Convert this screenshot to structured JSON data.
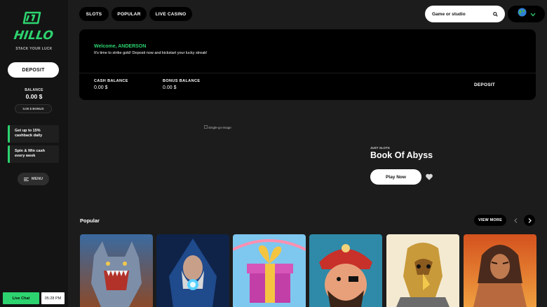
{
  "sidebar": {
    "logo_text": "HILLO",
    "tagline": "STACK YOUR LUCK",
    "deposit_label": "DEPOSIT",
    "balance_label": "BALANCE",
    "balance_value": "0.00 $",
    "bonus_text": "0.00 $ BONUS",
    "promos": [
      {
        "line1": "Get up to 15%",
        "line2": "cashback daily"
      },
      {
        "line1": "Spin & Win cash",
        "line2": "every week"
      }
    ],
    "menu_label": "MENU",
    "live_chat_label": "Live Chat",
    "clock": "05:28 PM"
  },
  "nav": {
    "tabs": [
      "SLOTS",
      "POPULAR",
      "LIVE CASINO"
    ],
    "search_placeholder": "Game or studio"
  },
  "welcome": {
    "greeting": "Welcome, ANDERSON",
    "message": "It's time to strike gold! Deposit now and kickstart your lucky streak!",
    "cash_label": "CASH BALANCE",
    "cash_value": "0.00 $",
    "bonus_label": "BONUS BALANCE",
    "bonus_value": "0.00 $",
    "deposit_label": "DEPOSIT"
  },
  "hero": {
    "image_alt": "Single-go-image",
    "category": "JUST SLOTS",
    "title": "Book Of Abyss",
    "play_label": "Play Now"
  },
  "popular": {
    "title": "Popular",
    "view_more_label": "VIEW MORE",
    "tiles": [
      "werewolf",
      "wizard",
      "gift-box",
      "pirate",
      "eagle-warrior",
      "gladiator"
    ]
  },
  "colors": {
    "accent_green": "#2dd36f",
    "sidebar_bg": "#141414",
    "page_bg": "#1c1c1c",
    "card_bg": "#000000"
  }
}
